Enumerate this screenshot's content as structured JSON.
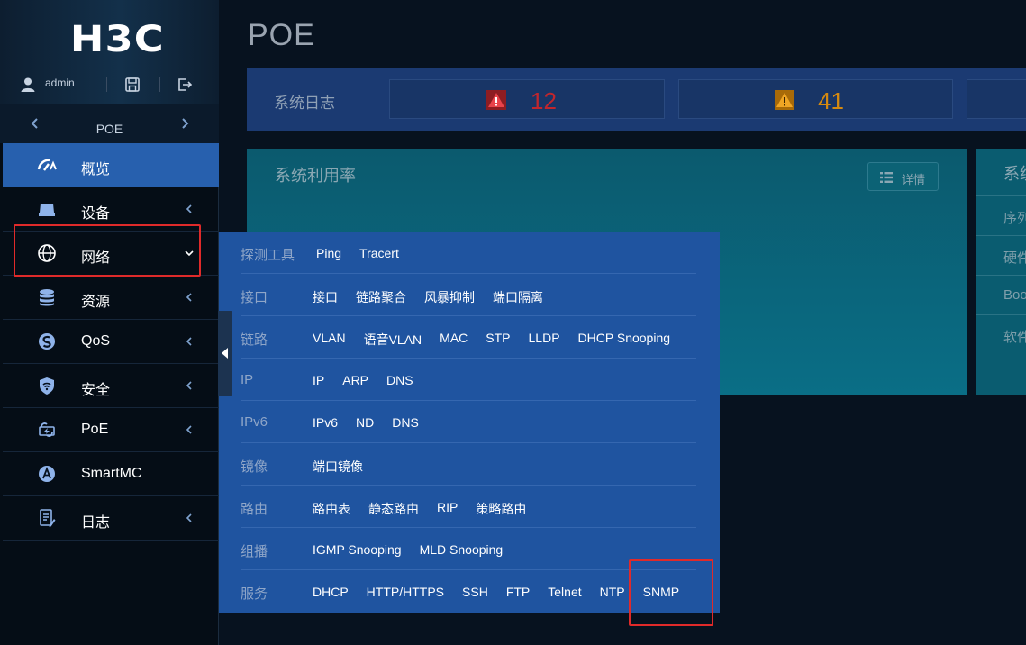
{
  "brand": {
    "logo_text": "H3C"
  },
  "user": {
    "name": "admin"
  },
  "nav_switch": {
    "label": "POE"
  },
  "menu": [
    {
      "label": "概览",
      "icon": "dashboard-icon",
      "active": true,
      "has_arrow": false,
      "arrow": ""
    },
    {
      "label": "设备",
      "icon": "device-icon",
      "active": false,
      "has_arrow": true,
      "arrow": "left"
    },
    {
      "label": "网络",
      "icon": "globe-icon",
      "active": false,
      "has_arrow": true,
      "arrow": "down"
    },
    {
      "label": "资源",
      "icon": "database-icon",
      "active": false,
      "has_arrow": true,
      "arrow": "left"
    },
    {
      "label": "QoS",
      "icon": "qos-icon",
      "active": false,
      "has_arrow": true,
      "arrow": "left"
    },
    {
      "label": "安全",
      "icon": "shield-icon",
      "active": false,
      "has_arrow": true,
      "arrow": "left"
    },
    {
      "label": "PoE",
      "icon": "poe-icon",
      "active": false,
      "has_arrow": true,
      "arrow": "left"
    },
    {
      "label": "SmartMC",
      "icon": "smartmc-icon",
      "active": false,
      "has_arrow": false,
      "arrow": ""
    },
    {
      "label": "日志",
      "icon": "log-icon",
      "active": false,
      "has_arrow": true,
      "arrow": "left"
    }
  ],
  "page": {
    "title": "POE"
  },
  "system_log": {
    "label": "系统日志",
    "critical_count": "12",
    "warning_count": "41",
    "critical_color": "#c0262d",
    "warning_color": "#d58a10"
  },
  "utilization": {
    "title": "系统利用率",
    "detail_label": "详情"
  },
  "system_info": {
    "title": "系统",
    "rows": [
      "序列",
      "硬件",
      "Boot",
      "软件"
    ]
  },
  "flyout": {
    "rows": [
      {
        "category": "探测工具",
        "links": [
          "Ping",
          "Tracert"
        ]
      },
      {
        "category": "接口",
        "links": [
          "接口",
          "链路聚合",
          "风暴抑制",
          "端口隔离"
        ]
      },
      {
        "category": "链路",
        "links": [
          "VLAN",
          "语音VLAN",
          "MAC",
          "STP",
          "LLDP",
          "DHCP Snooping"
        ]
      },
      {
        "category": "IP",
        "links": [
          "IP",
          "ARP",
          "DNS"
        ]
      },
      {
        "category": "IPv6",
        "links": [
          "IPv6",
          "ND",
          "DNS"
        ]
      },
      {
        "category": "镜像",
        "links": [
          "端口镜像"
        ]
      },
      {
        "category": "路由",
        "links": [
          "路由表",
          "静态路由",
          "RIP",
          "策略路由"
        ]
      },
      {
        "category": "组播",
        "links": [
          "IGMP Snooping",
          "MLD Snooping"
        ]
      },
      {
        "category": "服务",
        "links": [
          "DHCP",
          "HTTP/HTTPS",
          "SSH",
          "FTP",
          "Telnet",
          "NTP",
          "SNMP"
        ]
      }
    ]
  },
  "colors": {
    "active_menu": "#2760ae",
    "flyout_bg": "#1f54a0",
    "highlight": "#e02a2a"
  }
}
